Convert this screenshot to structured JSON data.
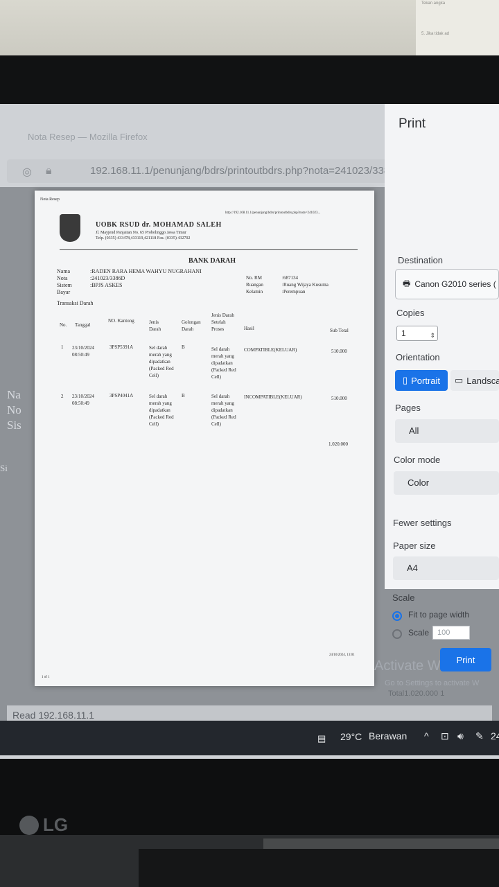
{
  "browser": {
    "tab_title": "Nota Resep — Mozilla Firefox",
    "address": "192.168.11.1/penunjang/bdrs/printoutbdrs.php?nota=241023/3386D"
  },
  "background_fragments": [
    "Na",
    "No",
    "Sis",
    "Si"
  ],
  "preview": {
    "header_left": "Nota Resep",
    "url_small": "http://192.168.11.1/penunjang/bdrs/printoutbdrs.php?nota=241023...",
    "hospital_name": "UOBK RSUD dr. MOHAMAD SALEH",
    "hospital_address": "Jl. Mayjend Panjaitan No. 65 Probolinggo Jawa Timur",
    "hospital_phone": "Telp. (0335) 433478,433119,421118 Fax. (0335) 432702",
    "doc_title": "BANK DARAH",
    "patient": {
      "nama_label": "Nama",
      "nama_value": ":RADEN RARA HEMA WAHYU NUGRAHANI",
      "nota_label": "Nota",
      "nota_value": ":241023/3386D",
      "sistem_label": "Sistem",
      "sistem_value": ":BPJS ASKES",
      "bayar_label": "Bayar",
      "rm_label": "No. RM",
      "rm_value": ":687134",
      "ruangan_label": "Ruangan",
      "ruangan_value": ":Ruang Wijaya Kusuma",
      "kelamin_label": "Kelamin",
      "kelamin_value": ":Perempuan"
    },
    "section_title": "Transaksi Darah",
    "table_headers": {
      "no": "No.",
      "tanggal": "Tanggal",
      "no_kantong": "NO. Kantong",
      "jenis_darah": "Jenis Darah",
      "golongan_darah": "Golongan Darah",
      "jenis_setelah": "Jenis Darah Setelah Proses",
      "hasil": "Hasil",
      "sub_total": "Sub Total"
    },
    "rows": [
      {
        "no": "1",
        "tanggal": "23/10/2024 08:50:49",
        "kantong": "3PSP5391A",
        "jenis": "Sel darah merah yang dipadatkan (Packed Red Cell)",
        "golongan": "B",
        "setelah": "Sel darah merah yang dipadatkan (Packed Red Cell)",
        "hasil": "COMPATIBLE(KELUAR)",
        "subtotal": "510.000"
      },
      {
        "no": "2",
        "tanggal": "23/10/2024 08:50:49",
        "kantong": "3PSP4041A",
        "jenis": "Sel darah merah yang dipadatkan (Packed Red Cell)",
        "golongan": "B",
        "setelah": "Sel darah merah yang dipadatkan (Packed Red Cell)",
        "hasil": "INCOMPATIBLE(KELUAR)",
        "subtotal": "510.000"
      }
    ],
    "total": "1.020.000",
    "footer_date": "24/10/2024, 13:01",
    "page_count": "1 of 1"
  },
  "print_dialog": {
    "title": "Print",
    "destination_label": "Destination",
    "destination_value": "Canon G2010 series (",
    "copies_label": "Copies",
    "copies_value": "1",
    "orientation_label": "Orientation",
    "portrait_label": "Portrait",
    "landscape_label": "Landsca",
    "pages_label": "Pages",
    "pages_value": "All",
    "color_mode_label": "Color mode",
    "color_mode_value": "Color",
    "fewer_settings": "Fewer settings",
    "paper_size_label": "Paper size",
    "paper_size_value": "A4",
    "scale_label": "Scale",
    "fit_label": "Fit to page width",
    "scale_option_label": "Scale",
    "scale_value": "100",
    "print_button": "Print"
  },
  "watermark": {
    "line1": "Activate Windows",
    "line2": "Go to Settings to activate W"
  },
  "status_text": "Read 192.168.11.1",
  "totals_strip": "Total1.020.000 1",
  "taskbar": {
    "weather_temp": "29°C",
    "weather_desc": "Berawan",
    "clock_partial": "24"
  },
  "monitor_brand": "LG"
}
